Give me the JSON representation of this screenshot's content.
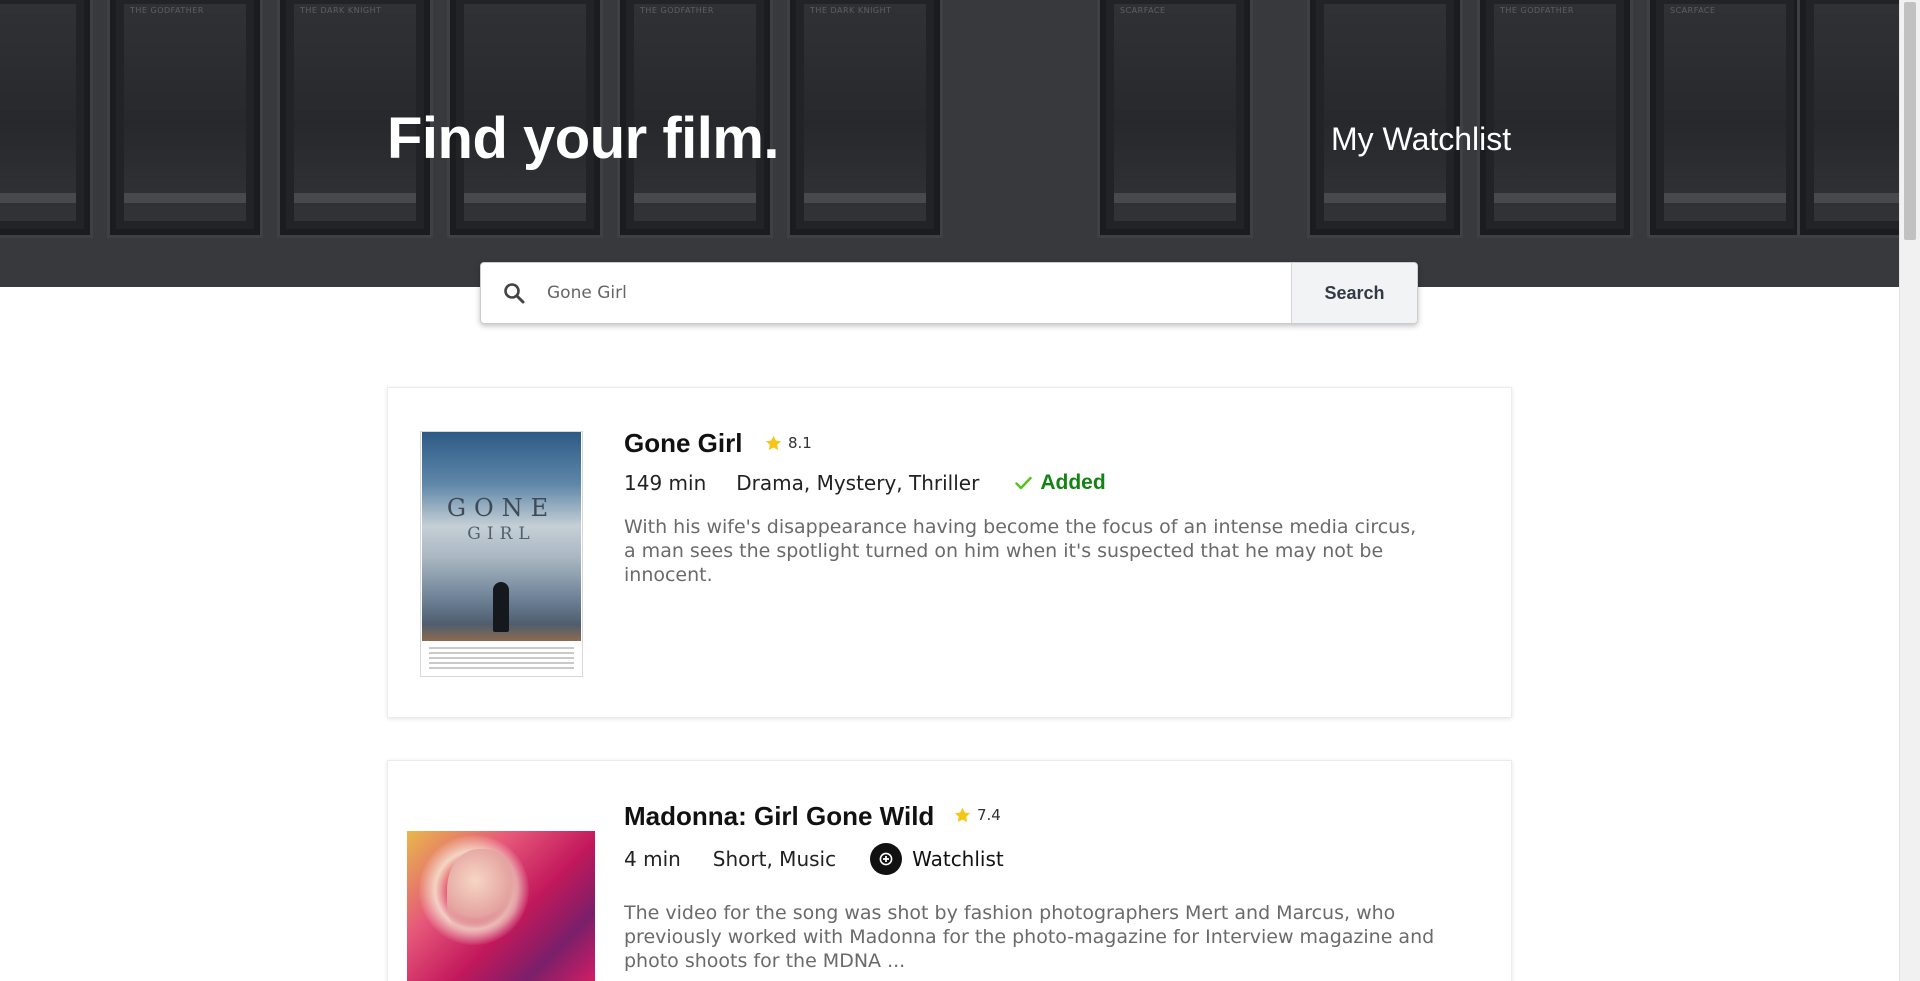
{
  "header": {
    "title": "Find your film.",
    "watchlist_link": "My Watchlist"
  },
  "search": {
    "value": "Gone Girl",
    "button_label": "Search",
    "icon": "search-icon"
  },
  "results": [
    {
      "title": "Gone Girl",
      "rating": "8.1",
      "runtime": "149 min",
      "genres": "Drama, Mystery, Thriller",
      "status_label": "Added",
      "plot": "With his wife's disappearance having become the focus of an intense media circus, a man sees the spotlight turned on him when it's suspected that he may not be innocent.",
      "poster_text": {
        "line1": "GONE",
        "line2": "GIRL"
      }
    },
    {
      "title": "Madonna: Girl Gone Wild",
      "rating": "7.4",
      "runtime": "4 min",
      "genres": "Short, Music",
      "action_label": "Watchlist",
      "plot": "The video for the song was shot by fashion photographers Mert and Marcus, who previously worked with Madonna for the photo-magazine for Interview magazine and photo shoots for the MDNA ..."
    }
  ],
  "colors": {
    "added_green": "#138413",
    "check_green": "#52c41a",
    "star_yellow": "#f5c518",
    "plot_gray": "#6a6a6a"
  }
}
